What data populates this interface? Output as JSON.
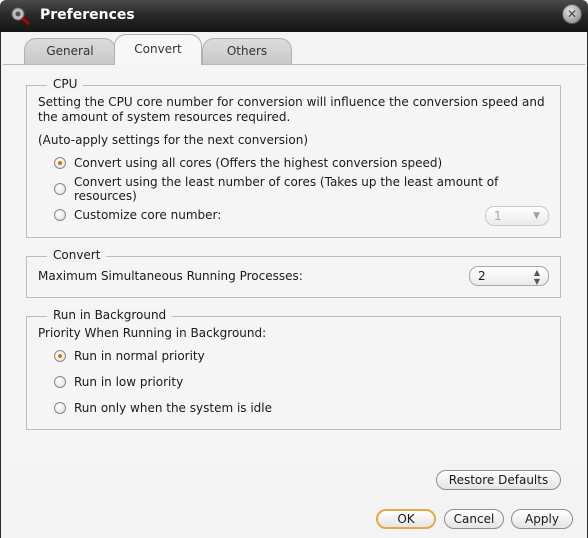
{
  "window": {
    "title": "Preferences",
    "icon": "app-logo-icon",
    "close_icon": "close-icon"
  },
  "tabs": [
    {
      "label": "General"
    },
    {
      "label": "Convert",
      "active": true
    },
    {
      "label": "Others"
    }
  ],
  "cpu": {
    "legend": "CPU",
    "description": "Setting the CPU core number for conversion will influence the conversion speed and the amount of system resources required.",
    "note": "(Auto-apply settings for the next conversion)",
    "options": [
      {
        "label": "Convert using all cores (Offers the highest conversion speed)",
        "selected": true
      },
      {
        "label": "Convert using the least number of cores (Takes up the least amount of resources)",
        "selected": false
      },
      {
        "label": "Customize core number:",
        "selected": false
      }
    ],
    "core_number": "1"
  },
  "convert": {
    "legend": "Convert",
    "max_processes_label": "Maximum Simultaneous Running Processes:",
    "max_processes_value": "2"
  },
  "background": {
    "legend": "Run in Background",
    "priority_label": "Priority When Running in Background:",
    "options": [
      {
        "label": "Run in normal priority",
        "selected": true
      },
      {
        "label": "Run in low priority",
        "selected": false
      },
      {
        "label": "Run only when the system is idle",
        "selected": false
      }
    ]
  },
  "buttons": {
    "restore": "Restore Defaults",
    "ok": "OK",
    "cancel": "Cancel",
    "apply": "Apply"
  },
  "colors": {
    "titlebar": "#1e1e1e",
    "radio_selected": "#d9700e",
    "default_button_border": "#e2a84a"
  }
}
